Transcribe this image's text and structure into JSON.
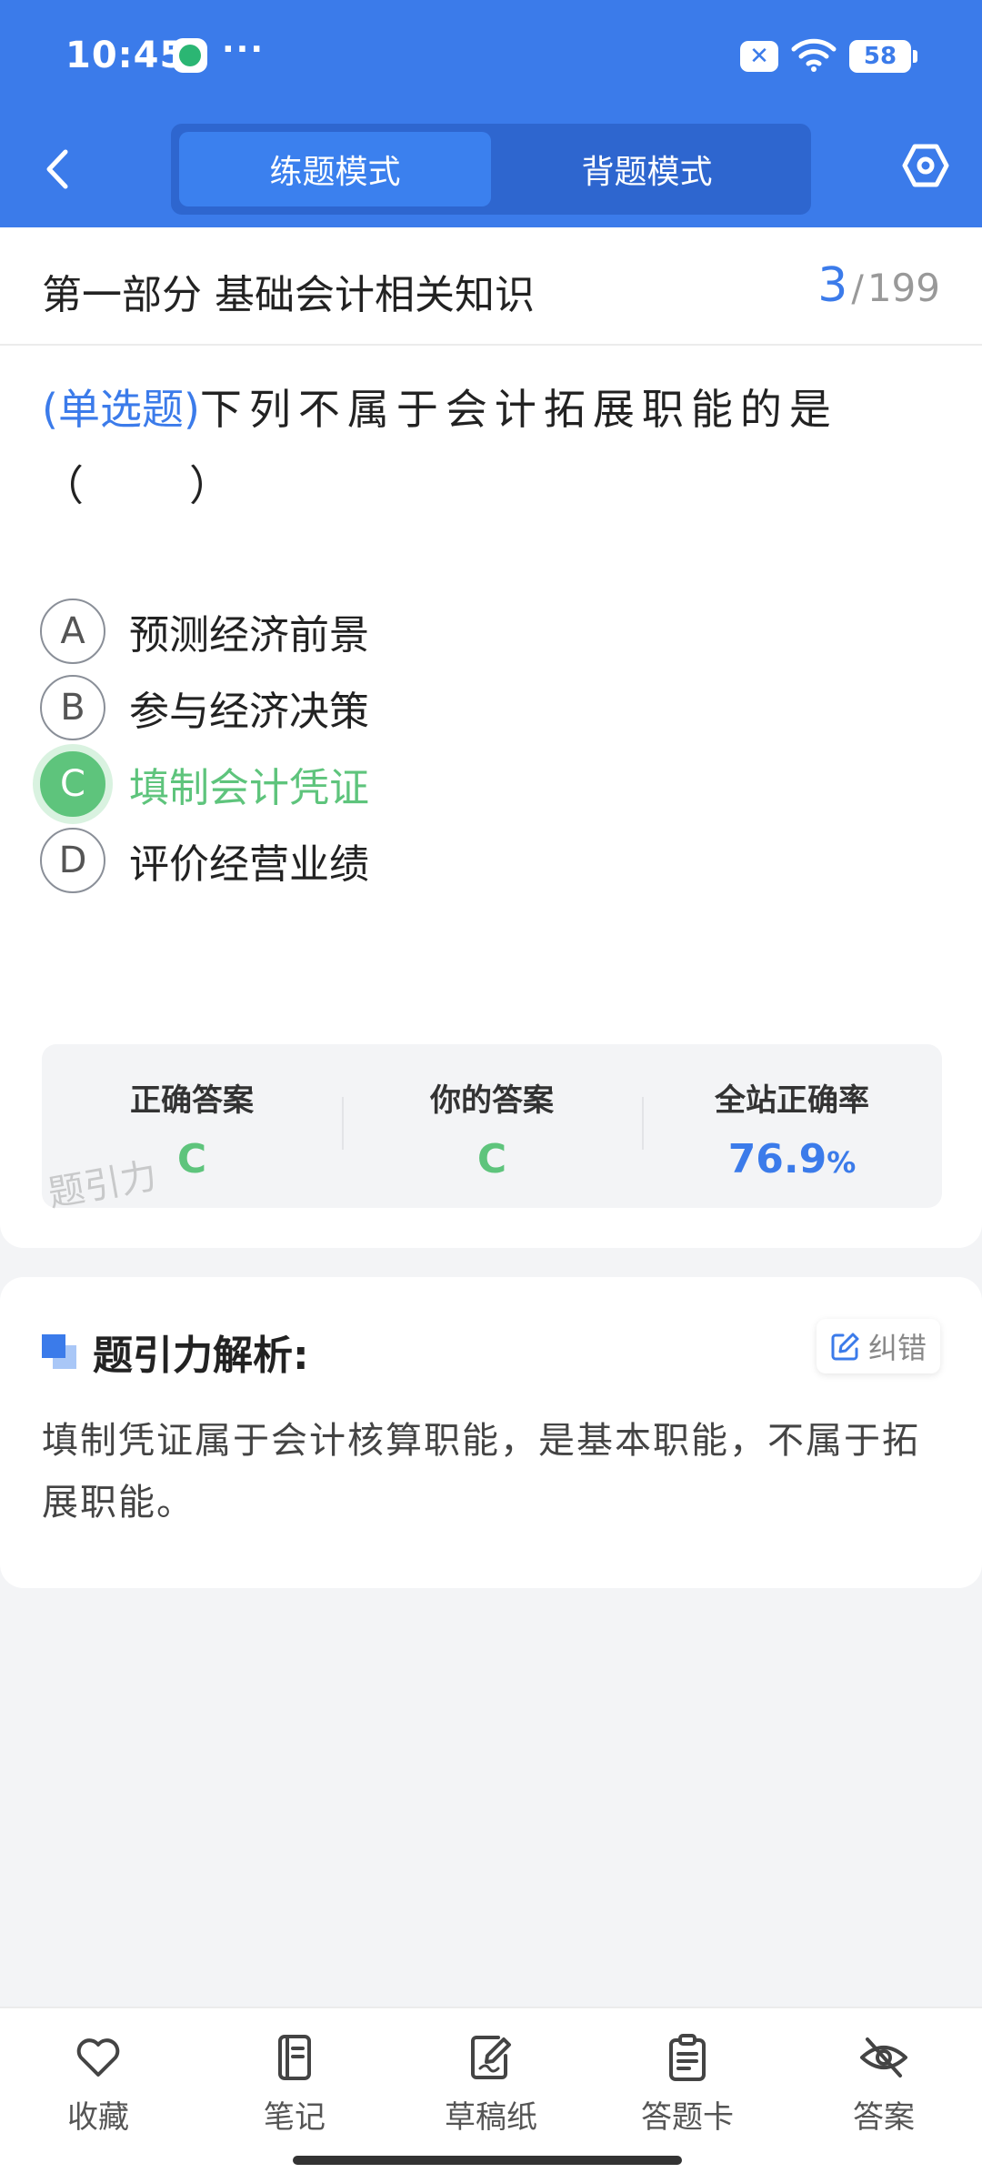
{
  "status_bar": {
    "time": "10:45",
    "dots": "···",
    "sim_label": "✕",
    "battery": "58"
  },
  "nav": {
    "modes": [
      "练题模式",
      "背题模式"
    ],
    "active_mode": 0
  },
  "section": {
    "title": "第一部分 基础会计相关知识",
    "current": "3",
    "separator": "/",
    "total": "199"
  },
  "question": {
    "type": "(单选题)",
    "text": "下列不属于会计拓展职能的是（　　）",
    "options": [
      {
        "letter": "A",
        "text": "预测经济前景"
      },
      {
        "letter": "B",
        "text": "参与经济决策"
      },
      {
        "letter": "C",
        "text": "填制会计凭证"
      },
      {
        "letter": "D",
        "text": "评价经营业绩"
      }
    ],
    "selected": "C"
  },
  "answer_summary": {
    "correct_label": "正确答案",
    "correct_value": "C",
    "yours_label": "你的答案",
    "yours_value": "C",
    "rate_label": "全站正确率",
    "rate_value": "76.9",
    "rate_unit": "%",
    "watermark": "题引力"
  },
  "analysis": {
    "title": "题引力解析:",
    "report_label": "纠错",
    "text": "填制凭证属于会计核算职能，是基本职能，不属于拓展职能。"
  },
  "bottom_bar": [
    {
      "icon": "heart-icon",
      "label": "收藏"
    },
    {
      "icon": "notebook-icon",
      "label": "笔记"
    },
    {
      "icon": "draft-icon",
      "label": "草稿纸"
    },
    {
      "icon": "answer-sheet-icon",
      "label": "答题卡"
    },
    {
      "icon": "eye-off-icon",
      "label": "答案"
    }
  ],
  "colors": {
    "primary": "#3b7bea",
    "correct": "#5ec47c",
    "background": "#f3f4f6"
  }
}
